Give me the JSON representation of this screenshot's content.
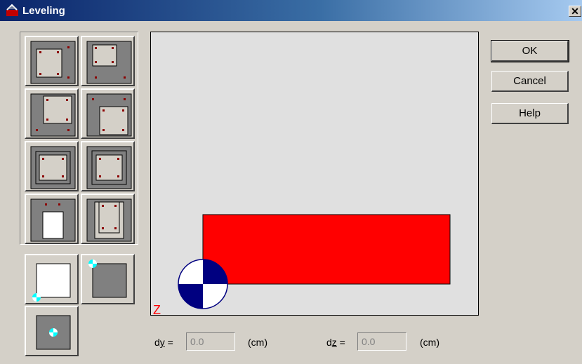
{
  "window": {
    "title": "Leveling",
    "close_glyph": "✕"
  },
  "buttons": {
    "ok": "OK",
    "cancel": "Cancel",
    "help": "Help"
  },
  "section_buttons": [
    {
      "name": "section-shape-1"
    },
    {
      "name": "section-shape-2"
    },
    {
      "name": "section-shape-3"
    },
    {
      "name": "section-shape-4"
    },
    {
      "name": "section-shape-5"
    },
    {
      "name": "section-shape-6"
    },
    {
      "name": "section-shape-7"
    },
    {
      "name": "section-shape-8"
    }
  ],
  "alignment_buttons": [
    {
      "name": "align-bottom-left"
    },
    {
      "name": "align-top-left"
    },
    {
      "name": "align-center"
    }
  ],
  "preview": {
    "axis_label": "Z",
    "shape_color": "#ff0000",
    "centroid_color": "#000080"
  },
  "offsets": {
    "dy": {
      "label_prefix": "d",
      "label_key": "y",
      "label_suffix": " =",
      "value": "0.0",
      "unit": "(cm)"
    },
    "dz": {
      "label_prefix": "d",
      "label_key": "z",
      "label_suffix": " =",
      "value": "0.0",
      "unit": "(cm)"
    }
  },
  "colors": {
    "dialog": "#d4d0c8",
    "titlebar": "#0a246a",
    "marker": "#00ffff"
  }
}
